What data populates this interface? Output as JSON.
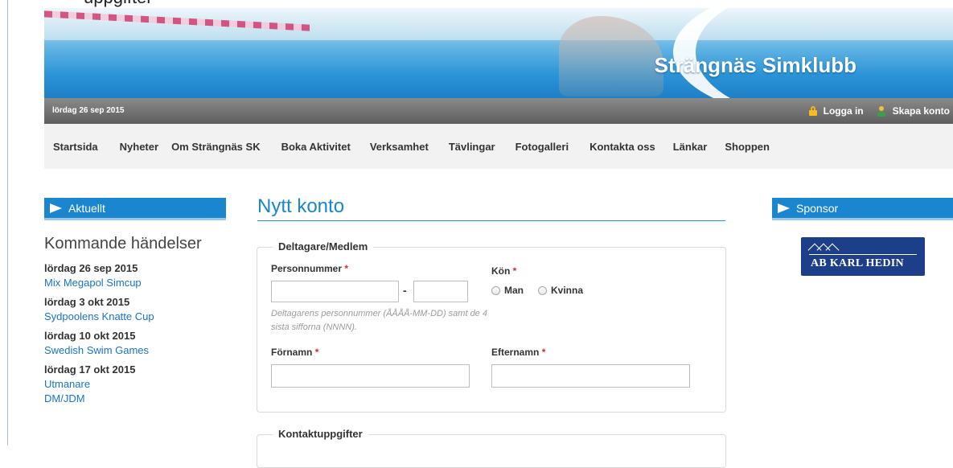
{
  "header": {
    "cut_text": "uppgifter",
    "site_title": "Strängnäs Simklubb",
    "date": "lördag 26 sep 2015",
    "login_label": "Logga in",
    "signup_label": "Skapa konto"
  },
  "nav": {
    "items": [
      "Startsida",
      "Nyheter",
      "Om Strängnäs SK",
      "Boka Aktivitet",
      "Verksamhet",
      "Tävlingar",
      "Fotogalleri",
      "Kontakta oss",
      "Länkar",
      "Shoppen"
    ]
  },
  "sidebar": {
    "heading": "Aktuellt",
    "events_title": "Kommande händelser",
    "events": [
      {
        "date": "lördag 26 sep 2015",
        "links": [
          "Mix Megapol Simcup"
        ]
      },
      {
        "date": "lördag 3 okt 2015",
        "links": [
          "Sydpoolens Knatte Cup"
        ]
      },
      {
        "date": "lördag 10 okt 2015",
        "links": [
          "Swedish Swim Games"
        ]
      },
      {
        "date": "lördag 17 okt 2015",
        "links": [
          "Utmanare",
          "DM/JDM"
        ]
      }
    ]
  },
  "form": {
    "page_title": "Nytt konto",
    "section1_legend": "Deltagare/Medlem",
    "personnummer_label": "Personnummer",
    "required_mark": "*",
    "dash": "-",
    "personnummer_hint": "Deltagarens personnummer (ÅÅÅÅ-MM-DD) samt de 4 sista sifforna (NNNN).",
    "kon_label": "Kön",
    "radio_man": "Man",
    "radio_kvinna": "Kvinna",
    "fornamn_label": "Förnamn",
    "efternamn_label": "Efternamn",
    "section2_legend": "Kontaktuppgifter"
  },
  "right": {
    "heading": "Sponsor",
    "sponsor_name": "AB KARL HEDIN"
  },
  "colors": {
    "accent": "#1a86d0",
    "required": "#c9302c",
    "link": "#1a73c6"
  }
}
